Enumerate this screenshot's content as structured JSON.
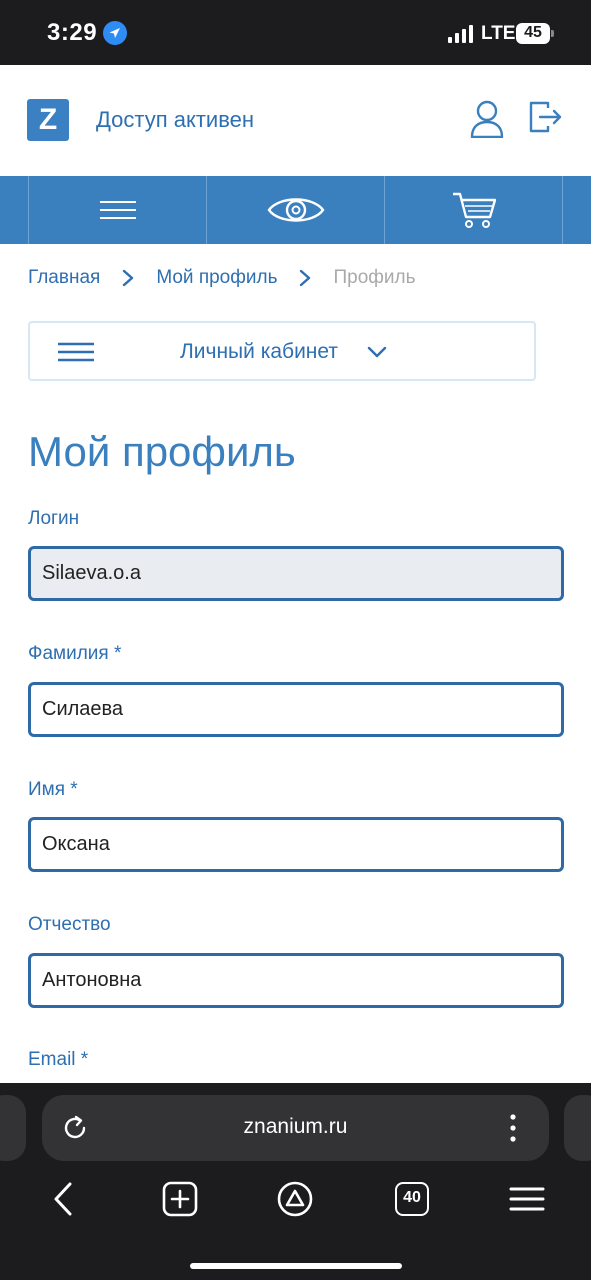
{
  "status_bar": {
    "time": "3:29",
    "network": "LTE",
    "battery": "45"
  },
  "header": {
    "logo_letter": "Z",
    "access_status": "Доступ активен"
  },
  "breadcrumb": {
    "items": [
      "Главная",
      "Мой профиль",
      "Профиль"
    ]
  },
  "cabinet_menu": {
    "label": "Личный кабинет"
  },
  "page": {
    "title": "Мой профиль"
  },
  "form": {
    "login": {
      "label": "Логин",
      "value": "Silaeva.o.a"
    },
    "last_name": {
      "label": "Фамилия *",
      "value": "Силаева"
    },
    "first_name": {
      "label": "Имя *",
      "value": "Оксана"
    },
    "middle_name": {
      "label": "Отчество",
      "value": "Антоновна"
    },
    "email": {
      "label": "Email *"
    }
  },
  "browser": {
    "url": "znanium.ru",
    "tab_count": "40"
  },
  "colors": {
    "brand_blue": "#3a7fbe",
    "link_blue": "#2e6fb1",
    "input_border": "#2f6aa6"
  }
}
